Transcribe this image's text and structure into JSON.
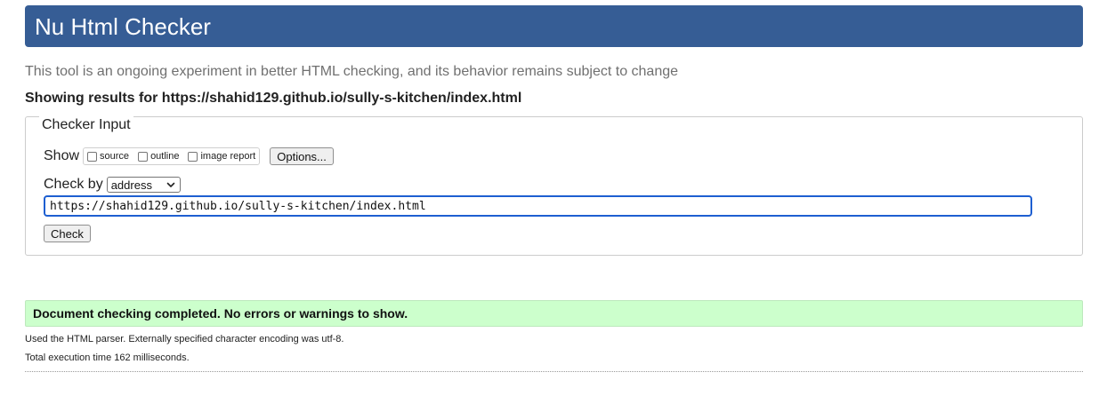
{
  "header": {
    "title": "Nu Html Checker"
  },
  "intro_text": "This tool is an ongoing experiment in better HTML checking, and its behavior remains subject to change",
  "results_heading": {
    "prefix": "Showing results for ",
    "url": "https://shahid129.github.io/sully-s-kitchen/index.html"
  },
  "checker_input": {
    "legend": "Checker Input",
    "show_label": "Show",
    "show_options": [
      {
        "label": "source",
        "checked": false
      },
      {
        "label": "outline",
        "checked": false
      },
      {
        "label": "image report",
        "checked": false
      }
    ],
    "options_button": "Options...",
    "check_by_label": "Check by",
    "check_by_selected": "address",
    "address_value": "https://shahid129.github.io/sully-s-kitchen/index.html",
    "check_button": "Check"
  },
  "result": {
    "success_message": "Document checking completed. No errors or warnings to show.",
    "parser_info": "Used the HTML parser. Externally specified character encoding was utf-8.",
    "execution_time": "Total execution time 162 milliseconds."
  },
  "colors": {
    "banner": "#365d95",
    "success_bg": "#ccffcc",
    "input_focus": "#1e5fd1"
  },
  "icons": {
    "select_arrow": "chevron-down-icon"
  }
}
